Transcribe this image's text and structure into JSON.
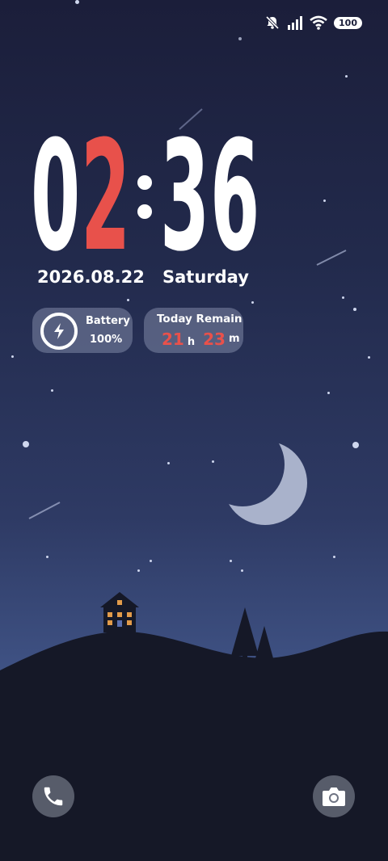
{
  "status_bar": {
    "icons": [
      "bell-muted-icon",
      "signal-icon",
      "wifi-icon"
    ],
    "battery_level": "100"
  },
  "clock": {
    "hour_tens": "0",
    "hour_ones": "2",
    "minute_tens": "3",
    "minute_ones": "6",
    "accent_color": "#e8514b"
  },
  "date": "2026.08.22",
  "weekday": "Saturday",
  "battery_widget": {
    "label": "Battery",
    "value": "100%",
    "icon": "lightning-icon"
  },
  "remain_widget": {
    "label": "Today Remain",
    "hours": "21",
    "hours_unit": "h",
    "minutes": "23",
    "minutes_unit": "m"
  },
  "shortcuts": {
    "left_icon": "phone-icon",
    "right_icon": "camera-icon"
  }
}
